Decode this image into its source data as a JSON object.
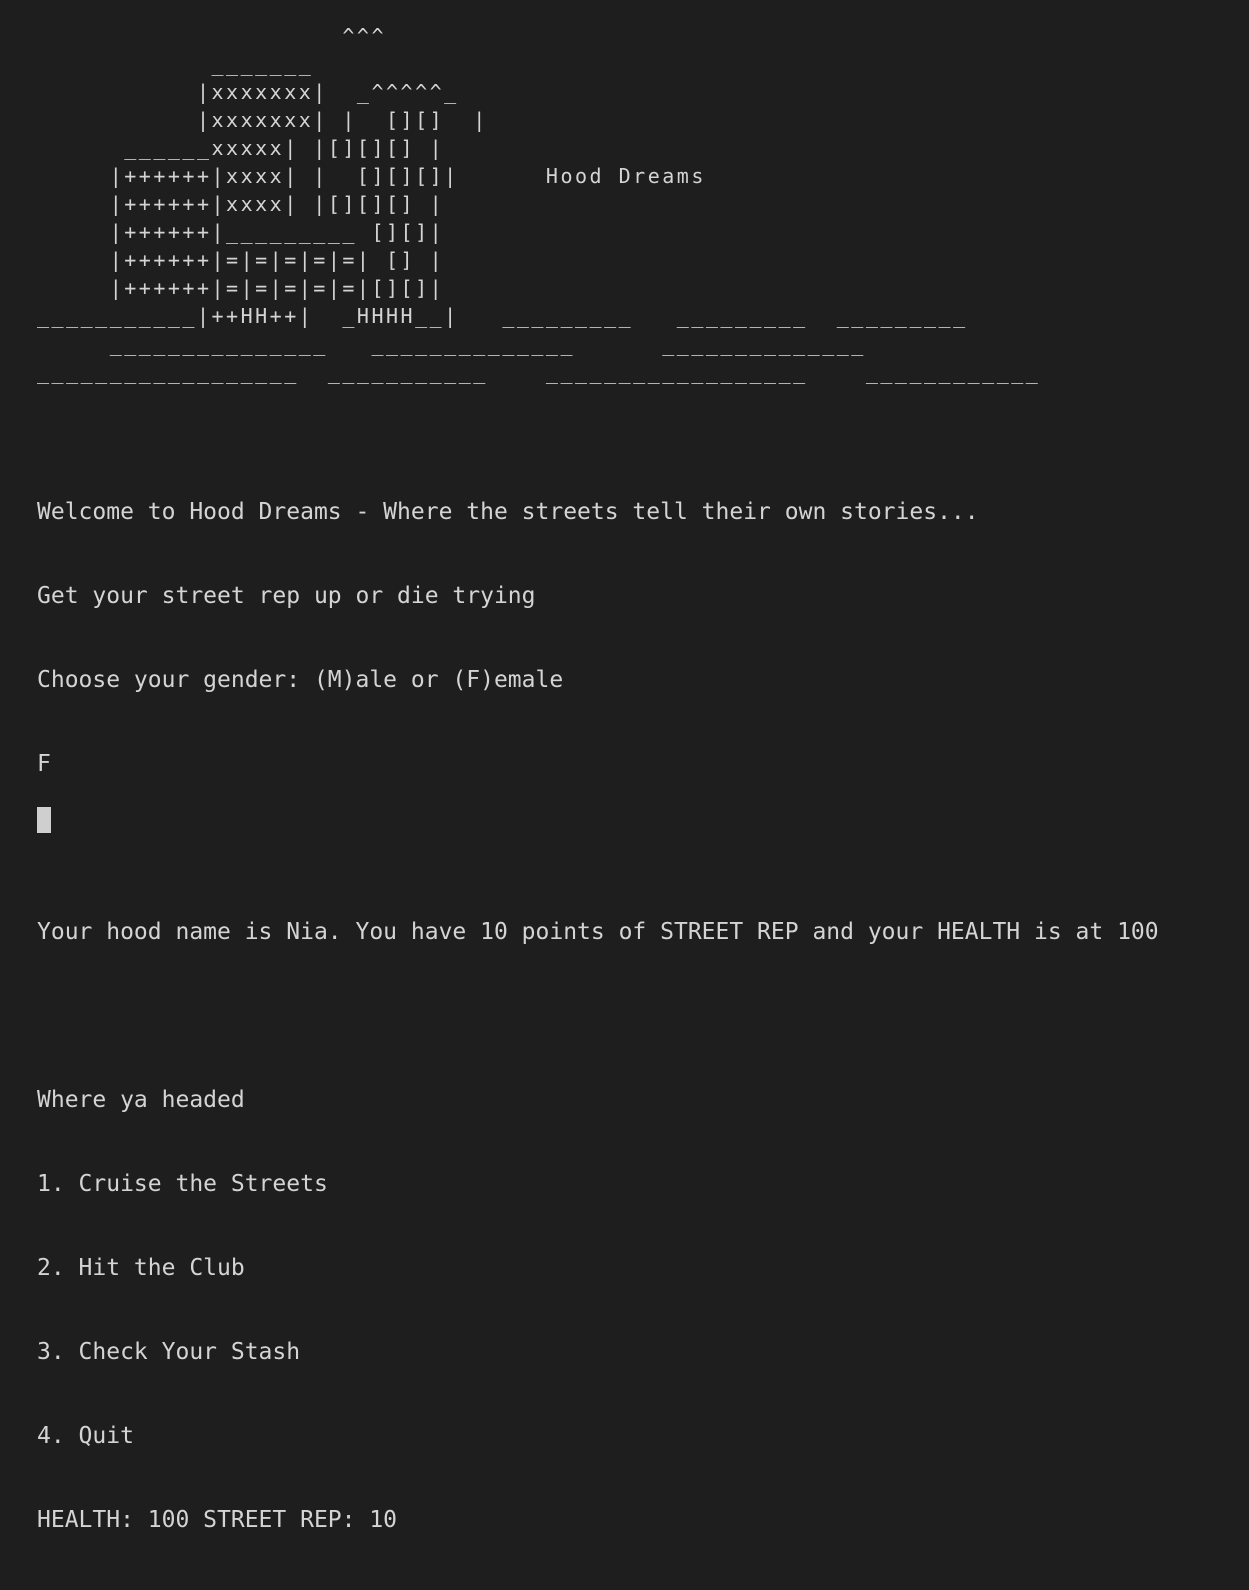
{
  "ascii_art": {
    "lines": [
      "                     ^^^",
      "            _______",
      "           |xxxxxxx|  _^^^^^_",
      "           |xxxxxxx| |  [][]  |",
      "      ______xxxxx| |[][][] |",
      "     |++++++|xxxx| |  [][][]|      Hood Dreams",
      "     |++++++|xxxx| |[][][] |",
      "     |++++++|_________ [][]|",
      "     |++++++|=|=|=|=|=| [] |",
      "     |++++++|=|=|=|=|=|[][]|",
      "___________|++HH++|  _HHHH__|   _________   _________  _________",
      "     _______________   ______________      ______________",
      "__________________  ___________    __________________    ____________"
    ]
  },
  "output": {
    "welcome": "Welcome to Hood Dreams - Where the streets tell their own stories...",
    "tagline": "Get your street rep up or die trying",
    "gender_prompt": "Choose your gender: (M)ale or (F)emale",
    "gender_input": "F",
    "status_message": "Your hood name is Nia. You have 10 points of STREET REP and your HEALTH is at 100",
    "menu_prompt": "Where ya headed",
    "menu_items": [
      "1. Cruise the Streets",
      "2. Hit the Club",
      "3. Check Your Stash",
      "4. Quit"
    ],
    "stats_line": "HEALTH: 100 STREET REP: 10"
  }
}
